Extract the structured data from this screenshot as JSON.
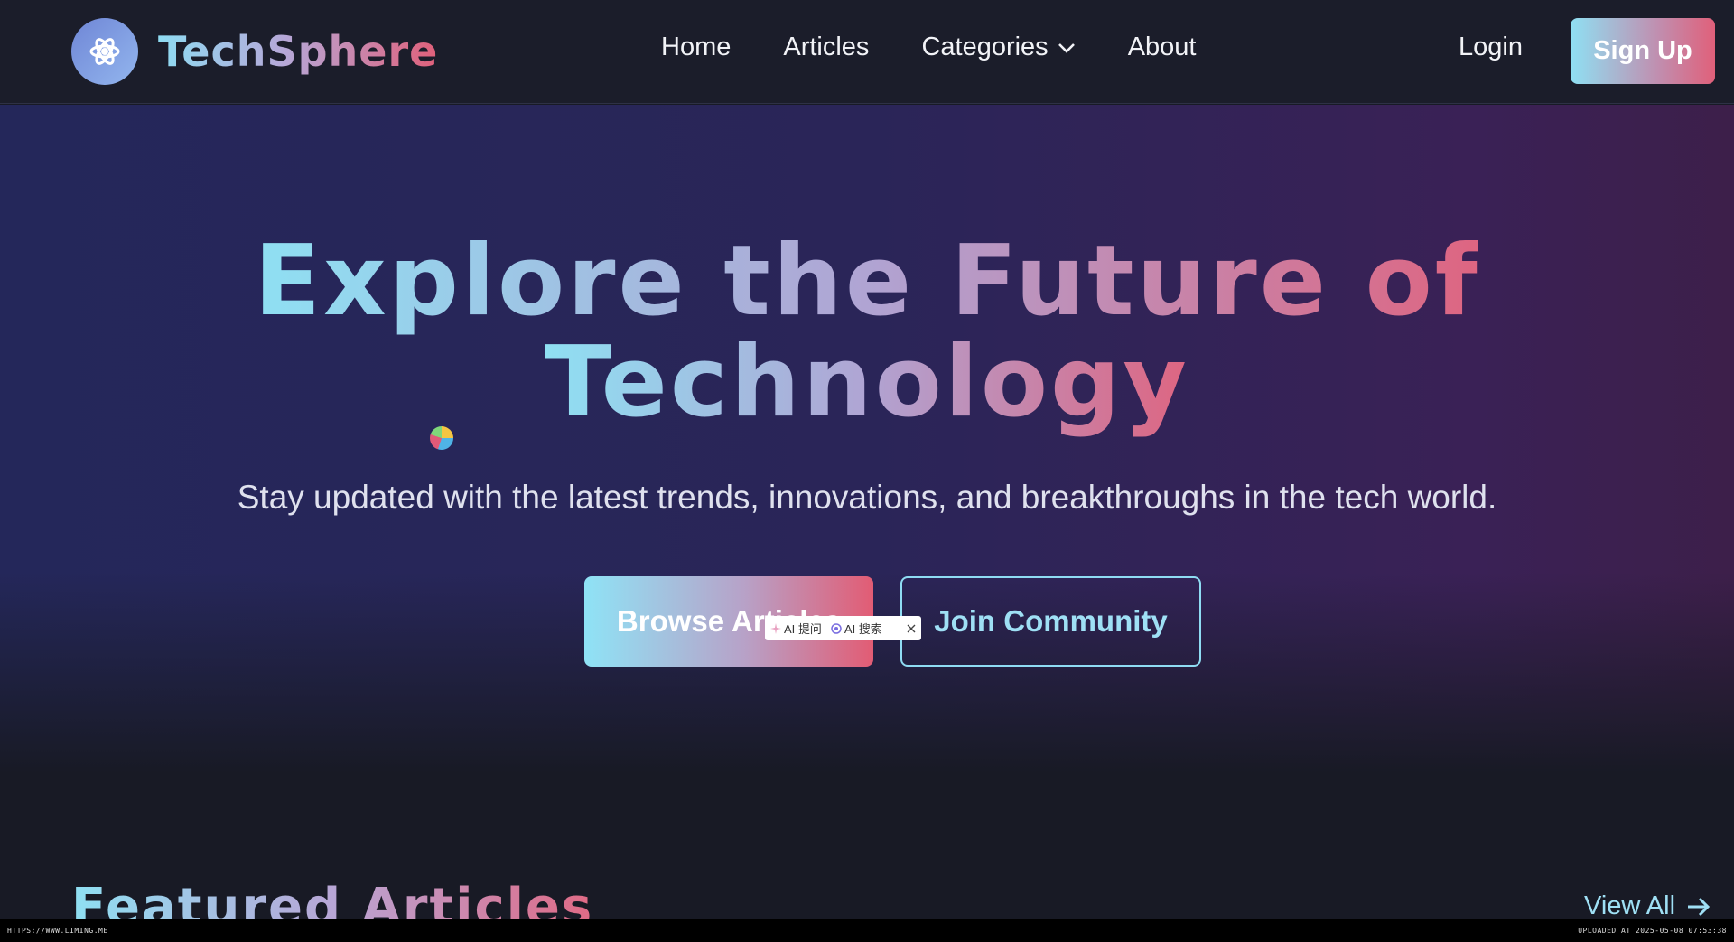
{
  "brand": {
    "name": "TechSphere",
    "icon": "atom-gear-icon"
  },
  "nav": {
    "links": [
      {
        "label": "Home"
      },
      {
        "label": "Articles"
      },
      {
        "label": "Categories"
      },
      {
        "label": "About"
      }
    ],
    "login_label": "Login",
    "signup_label": "Sign Up"
  },
  "hero": {
    "title_line1": "Explore the Future of",
    "title_line2": "Technology",
    "subtitle": "Stay updated with the latest trends, innovations, and breakthroughs in the tech world.",
    "primary_button": "Browse Articles",
    "secondary_button": "Join Community"
  },
  "ai_popup": {
    "ask_label": "AI 提问",
    "search_label": "AI 搜索"
  },
  "featured": {
    "title": "Featured Articles",
    "view_all": "View All"
  },
  "footer_strip": {
    "left": "HTTPS://WWW.LIMING.ME",
    "right": "UPLOADED AT 2025-05-08 07:53:38"
  },
  "colors": {
    "accent_cyan": "#8fe0f3",
    "accent_pink": "#e0607a",
    "navbar_bg": "#1b1d2a"
  }
}
